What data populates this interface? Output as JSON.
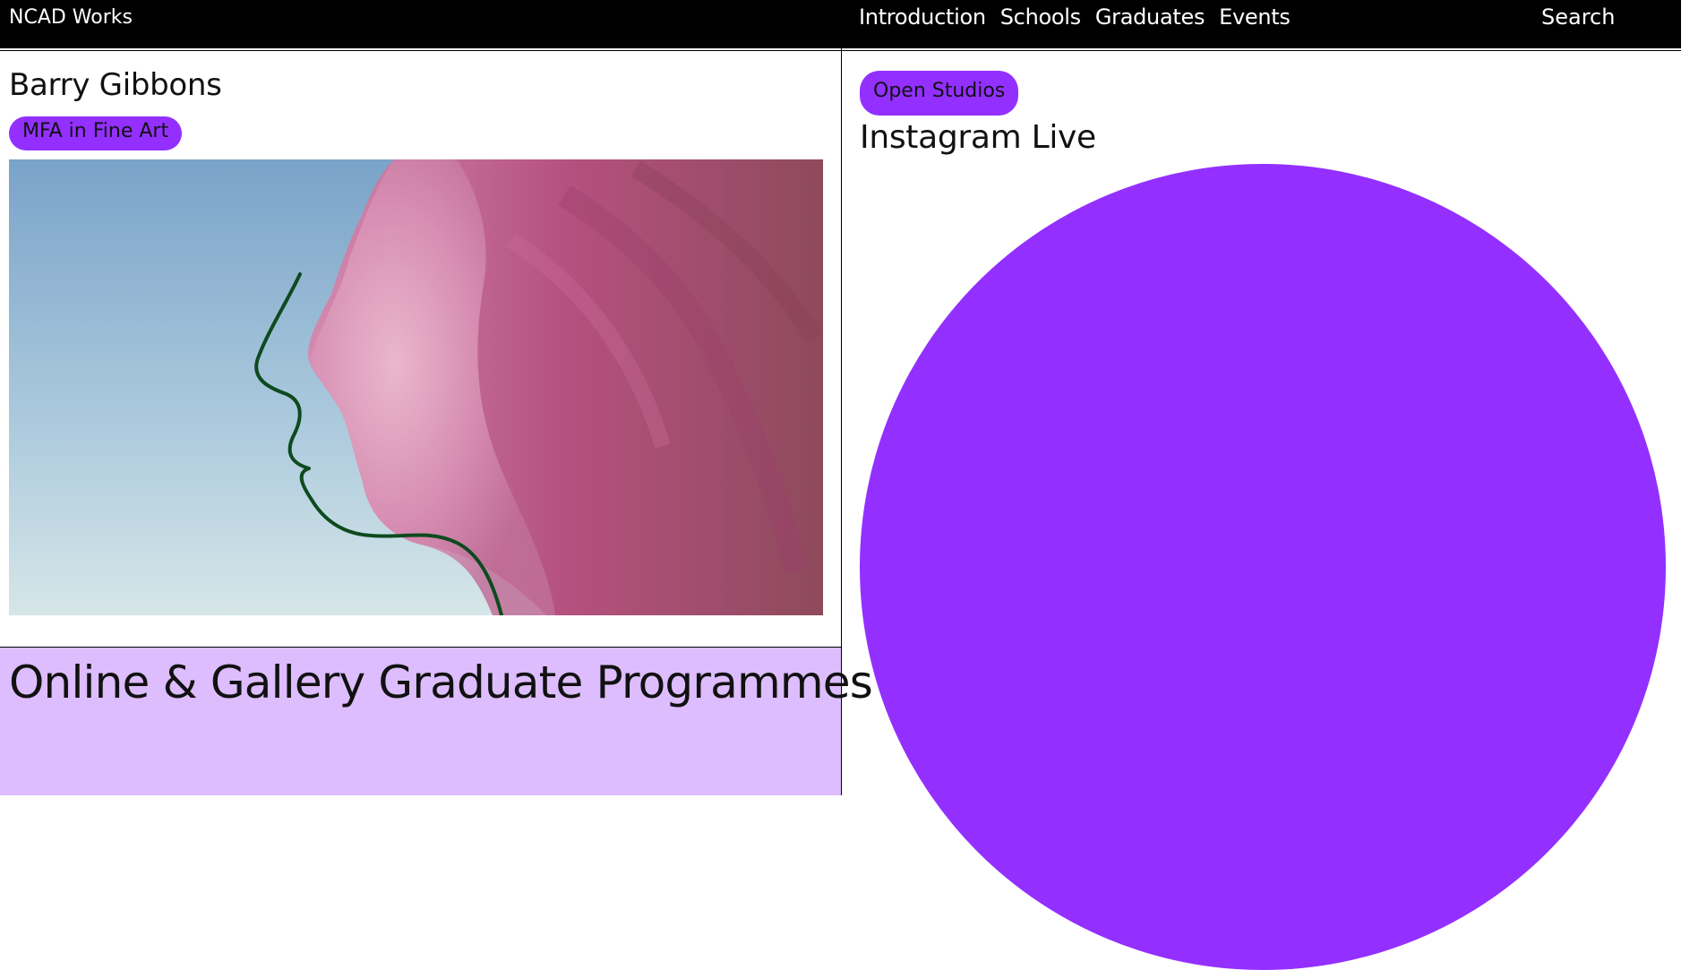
{
  "header": {
    "brand": "NCAD Works",
    "nav": [
      "Introduction",
      "Schools",
      "Graduates",
      "Events"
    ],
    "search_label": "Search"
  },
  "feature": {
    "artist_name": "Barry Gibbons",
    "programme_tag": "MFA in Fine Art"
  },
  "programmes": {
    "title": "Online & Gallery Graduate Programmes"
  },
  "event": {
    "tag": "Open Studios",
    "title": "Instagram Live"
  },
  "colors": {
    "accent": "#9330ff",
    "programmes_bg": "#ddbdfe",
    "header_bg": "#000000"
  }
}
